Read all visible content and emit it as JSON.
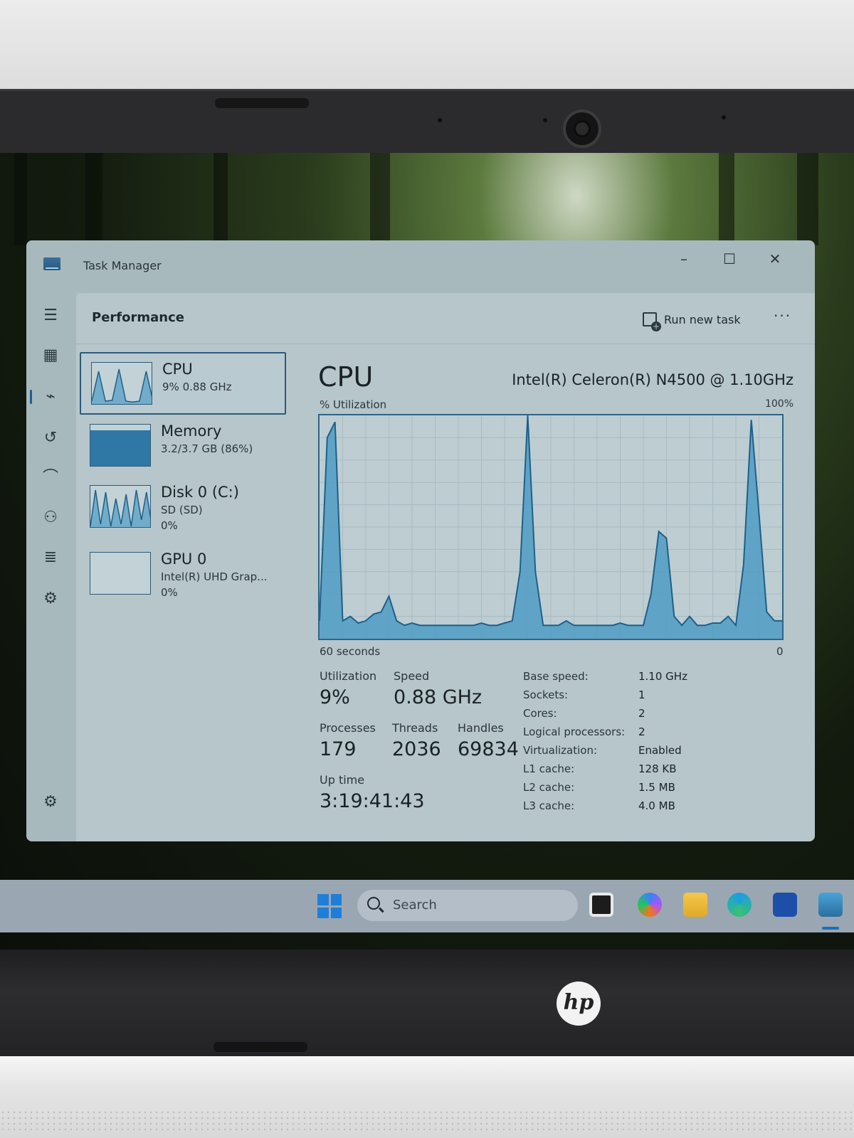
{
  "window": {
    "title": "Task Manager",
    "minimize": "–",
    "maximize": "☐",
    "close": "✕"
  },
  "nav": {
    "menu": "☰",
    "processes": "▦",
    "performance": "⌁",
    "app_history": "↺",
    "startup": "⌒",
    "users": "⚇",
    "details": "≣",
    "services": "⚙",
    "settings": "⚙"
  },
  "header": {
    "title": "Performance",
    "run_new_task": "Run new task",
    "more": "···"
  },
  "resources": [
    {
      "name": "CPU",
      "sub1": "9% 0.88 GHz",
      "sub2": ""
    },
    {
      "name": "Memory",
      "sub1": "3.2/3.7 GB (86%)",
      "sub2": ""
    },
    {
      "name": "Disk 0 (C:)",
      "sub1": "SD (SD)",
      "sub2": "0%"
    },
    {
      "name": "GPU 0",
      "sub1": "Intel(R) UHD Grap...",
      "sub2": "0%"
    }
  ],
  "memory_fill": 0.86,
  "cpu": {
    "title": "CPU",
    "model": "Intel(R) Celeron(R) N4500 @ 1.10GHz",
    "util_label": "% Utilization",
    "max_label": "100%",
    "axis_left": "60 seconds",
    "axis_right": "0",
    "utilization_label": "Utilization",
    "utilization": "9%",
    "speed_label": "Speed",
    "speed": "0.88 GHz",
    "processes_label": "Processes",
    "processes": "179",
    "threads_label": "Threads",
    "threads": "2036",
    "handles_label": "Handles",
    "handles": "69834",
    "uptime_label": "Up time",
    "uptime": "3:19:41:43",
    "specs": [
      {
        "k": "Base speed:",
        "v": "1.10 GHz"
      },
      {
        "k": "Sockets:",
        "v": "1"
      },
      {
        "k": "Cores:",
        "v": "2"
      },
      {
        "k": "Logical processors:",
        "v": "2"
      },
      {
        "k": "Virtualization:",
        "v": "Enabled"
      },
      {
        "k": "L1 cache:",
        "v": "128 KB"
      },
      {
        "k": "L2 cache:",
        "v": "1.5 MB"
      },
      {
        "k": "L3 cache:",
        "v": "4.0 MB"
      }
    ]
  },
  "chart_data": {
    "type": "area",
    "x": [
      0,
      1,
      2,
      3,
      4,
      5,
      6,
      7,
      8,
      9,
      10,
      11,
      12,
      13,
      14,
      15,
      16,
      17,
      18,
      19,
      20,
      21,
      22,
      23,
      24,
      25,
      26,
      27,
      28,
      29,
      30,
      31,
      32,
      33,
      34,
      35,
      36,
      37,
      38,
      39,
      40,
      41,
      42,
      43,
      44,
      45,
      46,
      47,
      48,
      49,
      50,
      51,
      52,
      53,
      54,
      55,
      56,
      57,
      58,
      59,
      60
    ],
    "values": [
      8,
      90,
      97,
      8,
      10,
      7,
      8,
      11,
      12,
      19,
      8,
      6,
      7,
      6,
      6,
      6,
      6,
      6,
      6,
      6,
      6,
      7,
      6,
      6,
      7,
      8,
      30,
      100,
      30,
      6,
      6,
      6,
      8,
      6,
      6,
      6,
      6,
      6,
      6,
      7,
      6,
      6,
      6,
      20,
      48,
      45,
      10,
      6,
      10,
      6,
      6,
      7,
      7,
      10,
      6,
      33,
      98,
      56,
      12,
      8,
      8
    ],
    "xlabel": "60 seconds",
    "ylabel": "% Utilization",
    "ylim": [
      0,
      100
    ],
    "grid": true
  },
  "thumbs": {
    "cpu": [
      10,
      80,
      10,
      12,
      85,
      10,
      8,
      10,
      80,
      10
    ],
    "disk": [
      5,
      90,
      10,
      85,
      5,
      70,
      10,
      80,
      5,
      90,
      20,
      85,
      10
    ]
  },
  "taskbar": {
    "search": "Search"
  },
  "brand": "hp"
}
